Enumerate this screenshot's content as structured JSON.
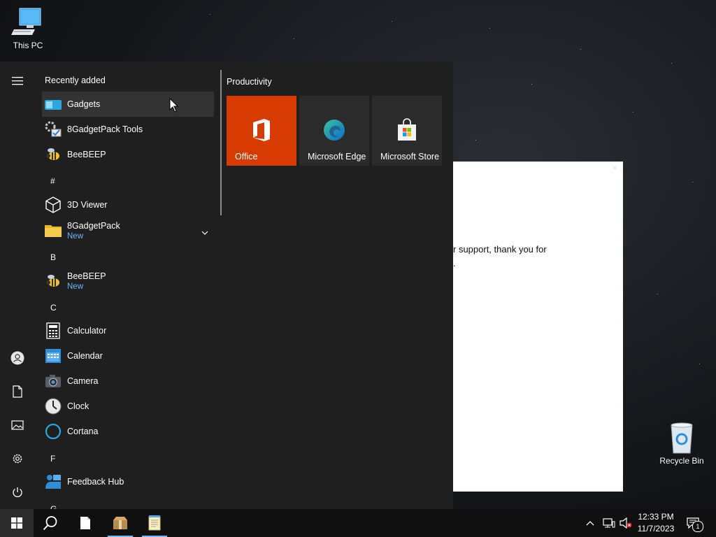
{
  "desktop": {
    "this_pc_label": "This PC",
    "recycle_bin_label": "Recycle Bin"
  },
  "background_window": {
    "close_glyph": "×",
    "line1": "r support, thank you for",
    "line2": "."
  },
  "start_menu": {
    "recently_added_header": "Recently added",
    "recent_items": [
      {
        "label": "Gadgets",
        "icon": "gadgets-icon"
      },
      {
        "label": "8GadgetPack Tools",
        "icon": "gadget-tools-icon"
      },
      {
        "label": "BeeBEEP",
        "icon": "bee-icon"
      }
    ],
    "sections": {
      "hash": "#",
      "b": "B",
      "c": "C",
      "f": "F",
      "g": "G"
    },
    "apps": {
      "viewer3d": "3D Viewer",
      "gadgetpack": "8GadgetPack",
      "gadgetpack_badge": "New",
      "beebeep": "BeeBEEP",
      "beebeep_badge": "New",
      "calculator": "Calculator",
      "calendar": "Calendar",
      "camera": "Camera",
      "clock": "Clock",
      "cortana": "Cortana",
      "feedback": "Feedback Hub"
    },
    "group_title": "Productivity",
    "tiles": [
      {
        "label": "Office",
        "color": "#d83b01"
      },
      {
        "label": "Microsoft Edge",
        "color": "#2b2b2b"
      },
      {
        "label": "Microsoft Store",
        "color": "#2b2b2b"
      }
    ]
  },
  "taskbar": {
    "time": "12:33 PM",
    "date": "11/7/2023",
    "notification_count": "1"
  },
  "colors": {
    "accent": "#76b9ed",
    "office_tile": "#d83b01",
    "menu_bg": "#1f1f1f",
    "new_badge": "#6fb7ff"
  }
}
